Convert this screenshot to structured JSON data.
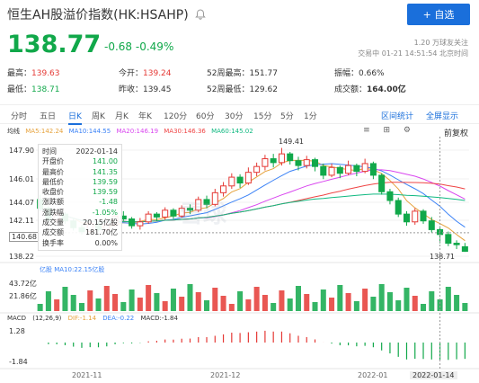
{
  "header": {
    "title": "恒生AH股溢价指数(HK:HSAHP)",
    "add_button_label": "+ 自选"
  },
  "quote": {
    "price": "138.77",
    "change": "-0.68",
    "change_pct": "-0.49%",
    "followers": "1.20 万球友关注",
    "trade_time": "交易中 01-21 14:51:54 北京时间"
  },
  "stats": {
    "high_label": "最高：",
    "high": "139.63",
    "open_label": "今开：",
    "open": "139.24",
    "w52_high_label": "52周最高：",
    "w52_high": "151.77",
    "amplitude_label": "振幅：",
    "amplitude": "0.66%",
    "low_label": "最低：",
    "low": "138.71",
    "prev_close_label": "昨收：",
    "prev_close": "139.45",
    "w52_low_label": "52周最低：",
    "w52_low": "129.62",
    "turnover_label": "成交额：",
    "turnover": "164.00亿"
  },
  "tabs": [
    "分时",
    "五日",
    "日K",
    "周K",
    "月K",
    "年K",
    "120分",
    "60分",
    "30分",
    "15分",
    "5分",
    "1分"
  ],
  "tab_links": [
    "区间统计",
    "全屏显示"
  ],
  "chart_controls": {
    "icons": "≡ ⊞ ⚙",
    "adjust": "前复权",
    "watermark": "雪球"
  },
  "ma_legend": {
    "label": "均线",
    "ma5": "MA5:142.24",
    "ma10": "MA10:144.55",
    "ma20": "MA20:146.19",
    "ma30": "MA30:146.36",
    "ma60": "MA60:145.02"
  },
  "tooltip": {
    "rows": [
      {
        "k": "时间",
        "v": "2022-01-14"
      },
      {
        "k": "开盘价",
        "v": "141.00"
      },
      {
        "k": "最高价",
        "v": "141.35"
      },
      {
        "k": "最低价",
        "v": "139.59"
      },
      {
        "k": "收盘价",
        "v": "139.59"
      },
      {
        "k": "涨跌额",
        "v": "-1.48"
      },
      {
        "k": "涨跌幅",
        "v": "-1.05%"
      },
      {
        "k": "成交量",
        "v": "20.15亿股"
      },
      {
        "k": "成交额",
        "v": "181.70亿"
      },
      {
        "k": "换手率",
        "v": "0.00%"
      }
    ]
  },
  "price_axis": {
    "labels": [
      "149.41",
      "147.90",
      "146.01",
      "144.07",
      "142.11",
      "140.68",
      "138.22"
    ],
    "current_tag": "140.68",
    "max_label": "149.41",
    "min_label": "138.71"
  },
  "volume": {
    "legend": "亿股  MA10:22.15亿股",
    "max_label": "43.72亿",
    "mid_label": "21.86亿"
  },
  "macd": {
    "label": "MACD",
    "params": "(12,26,9)",
    "dif": "DIF:-1.14",
    "dea": "DEA:-0.22",
    "macd": "MACD:-1.84",
    "top_label": "1.28",
    "bottom_label": "-1.84"
  },
  "x_axis": {
    "labels": [
      "2021-11",
      "2021-12",
      "2022-01"
    ],
    "date_tag": "2022-01-14"
  },
  "chart_data": {
    "type": "candlestick",
    "candles": [
      [
        144.1,
        143.2,
        144.6,
        142.9
      ],
      [
        143.2,
        142.0,
        143.4,
        141.8
      ],
      [
        142.0,
        142.6,
        142.9,
        141.7
      ],
      [
        142.6,
        141.9,
        142.8,
        141.6
      ],
      [
        141.9,
        141.2,
        142.1,
        140.9
      ],
      [
        141.2,
        140.8,
        141.5,
        140.5
      ],
      [
        140.8,
        141.6,
        141.9,
        140.6
      ],
      [
        141.6,
        141.0,
        141.8,
        140.8
      ],
      [
        141.0,
        141.5,
        141.9,
        140.8
      ],
      [
        141.5,
        142.4,
        142.6,
        141.3
      ],
      [
        142.4,
        142.1,
        142.9,
        141.9
      ],
      [
        142.1,
        141.4,
        142.3,
        141.1
      ],
      [
        141.4,
        141.8,
        142.2,
        141.0
      ],
      [
        141.8,
        142.6,
        142.9,
        141.6
      ],
      [
        142.6,
        142.3,
        142.8,
        141.9
      ],
      [
        142.3,
        143.0,
        143.3,
        142.0
      ],
      [
        143.0,
        142.4,
        143.2,
        142.1
      ],
      [
        142.4,
        143.2,
        143.5,
        142.2
      ],
      [
        143.2,
        143.0,
        143.6,
        142.6
      ],
      [
        143.0,
        144.1,
        144.4,
        142.8
      ],
      [
        144.1,
        143.6,
        144.5,
        143.2
      ],
      [
        143.6,
        144.8,
        145.2,
        143.4
      ],
      [
        144.8,
        145.5,
        145.9,
        144.4
      ],
      [
        145.5,
        146.4,
        146.8,
        145.2
      ],
      [
        146.4,
        145.8,
        146.7,
        145.3
      ],
      [
        145.8,
        146.9,
        147.4,
        145.6
      ],
      [
        146.9,
        147.5,
        147.9,
        146.5
      ],
      [
        147.5,
        148.3,
        148.7,
        147.1
      ],
      [
        148.3,
        147.9,
        148.8,
        147.4
      ],
      [
        147.9,
        148.8,
        149.41,
        147.6
      ],
      [
        148.8,
        148.1,
        149.0,
        147.7
      ],
      [
        148.1,
        147.6,
        148.5,
        147.1
      ],
      [
        147.6,
        148.2,
        148.6,
        147.3
      ],
      [
        148.2,
        147.5,
        148.4,
        147.0
      ],
      [
        147.5,
        146.6,
        147.8,
        146.2
      ],
      [
        146.6,
        147.4,
        147.8,
        146.4
      ],
      [
        147.4,
        146.8,
        147.6,
        146.3
      ],
      [
        146.8,
        147.6,
        148.1,
        146.6
      ],
      [
        147.6,
        147.0,
        147.8,
        146.5
      ],
      [
        147.0,
        147.8,
        148.3,
        146.8
      ],
      [
        147.8,
        146.6,
        148.0,
        146.2
      ],
      [
        146.6,
        144.9,
        146.8,
        144.6
      ],
      [
        144.9,
        144.0,
        145.2,
        143.6
      ],
      [
        144.0,
        142.6,
        144.3,
        142.3
      ],
      [
        142.6,
        141.8,
        142.9,
        141.4
      ],
      [
        141.8,
        142.9,
        143.2,
        141.5
      ],
      [
        142.9,
        141.9,
        143.1,
        141.6
      ],
      [
        141.9,
        141.0,
        142.3,
        140.7
      ],
      [
        141.0,
        140.5,
        141.35,
        139.59
      ],
      [
        140.5,
        139.6,
        140.8,
        139.3
      ],
      [
        139.6,
        139.45,
        139.9,
        139.0
      ],
      [
        139.24,
        138.77,
        139.63,
        138.71
      ]
    ]
  }
}
